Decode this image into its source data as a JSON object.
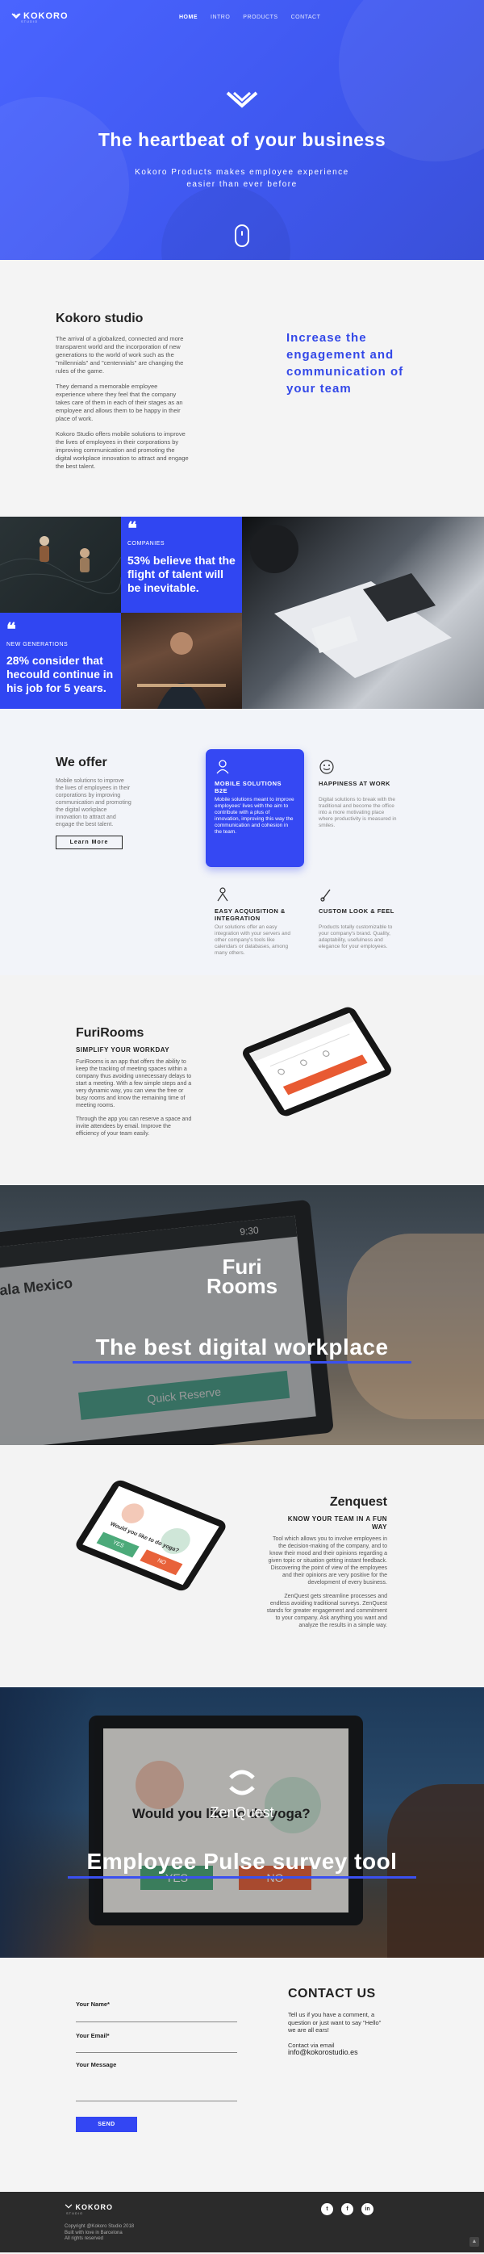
{
  "brand": {
    "name": "KOKORO",
    "sub": "STUDIO"
  },
  "nav": {
    "items": [
      "HOME",
      "INTRO",
      "PRODUCTS",
      "CONTACT"
    ]
  },
  "hero": {
    "title": "The heartbeat of your business",
    "subtitle": "Kokoro Products makes employee experience easier than ever before"
  },
  "studio": {
    "title": "Kokoro studio",
    "paragraphs": [
      "The arrival of a globalized, connected and more transparent world and the incorporation of new generations to the world of work such as the \"millennials\" and \"centennials\" are changing the rules of the game.",
      "They demand a memorable employee experience where they feel that the company takes care of them in each of their stages as an employee and allows them to be happy in their place of work.",
      "Kokoro Studio offers mobile solutions to improve the lives of employees in their corporations by improving communication and promoting the digital workplace innovation to attract and engage the best talent."
    ],
    "quote": "Increase the engagement and communication of your team"
  },
  "grid": {
    "companies": {
      "label": "COMPANIES",
      "stat": "53% believe that the flight of talent will be inevitable."
    },
    "generations": {
      "label": "NEW GENERATIONS",
      "stat": "28% consider that hecould continue in his job for 5 years."
    }
  },
  "offer": {
    "title": "We offer",
    "text": "Mobile solutions to improve the lives of employees in their corporations by improving communication and promoting the digital workplace innovation to attract and engage the best talent.",
    "button": "Learn More",
    "features": [
      {
        "title": "MOBILE SOLUTIONS B2E",
        "text": "Mobile solutions meant to improve employees' lives with the aim to contribute with a plus of innovation, improving this way the communication and cohesion in the team."
      },
      {
        "title": "HAPPINESS AT WORK",
        "text": "Digital solutions to break with the traditional and become the office into a more motivating place where productivity is measured in smiles."
      },
      {
        "title": "EASY ACQUISITION & INTEGRATION",
        "text": "Our solutions offer an easy integration with your servers and other company's tools like calendars or databases, among many others."
      },
      {
        "title": "CUSTOM LOOK & FEEL",
        "text": "Products totally customizable to your company's brand. Quality, adaptability, usefulness and elegance for your employees."
      }
    ]
  },
  "furirooms": {
    "title": "FuriRooms",
    "subtitle": "SIMPLIFY YOUR WORKDAY",
    "paragraphs": [
      "FuriRooms is an app that offers the ability to keep the tracking of meeting spaces within a company thus avoiding unnecessary delays to start a meeting. With a few simple steps and a very dynamic way, you can view the free or busy rooms and know the remaining time of meeting rooms.",
      "Through the app you can reserve a space and invite attendees by email. Improve the efficiency of your team easily."
    ]
  },
  "furiBanner": {
    "logo_line1": "Furi",
    "logo_line2": "Rooms",
    "title": "The best digital workplace",
    "screen_room": "Sala Mexico",
    "screen_time": "9:30",
    "screen_button": "Quick Reserve"
  },
  "zenquest": {
    "title": "Zenquest",
    "subtitle": "KNOW YOUR TEAM IN A FUN WAY",
    "paragraphs": [
      "Tool which allows you to involve employees in the decision-making of the company, and to know their mood and their opinions regarding a given topic or situation getting instant feedback. Discovering the point of view of the employees and their opinions are very positive for the development of every business.",
      "ZenQuest gets streamline processes and endless avoiding traditional surveys. ZenQuest stands for greater engagement and commitment to your company. Ask anything you want and analyze the results in a simple way."
    ],
    "screen_question": "Would you like to do yoga?",
    "screen_yes": "YES",
    "screen_no": "NO"
  },
  "zqBanner": {
    "question": "Would you like to do yoga?",
    "yes": "YES",
    "no": "NO",
    "logo": "ZenQuest",
    "title": "Employee Pulse survey tool"
  },
  "contact": {
    "name_label": "Your Name*",
    "email_label": "Your Email*",
    "message_label": "Your Message",
    "send": "SEND",
    "title": "CONTACT US",
    "text": "Tell us if you have a comment, a question or just want to say \"Hello\" we are all ears!",
    "email_intro": "Contact via email",
    "email": "info@kokorostudio.es"
  },
  "footer": {
    "copyright": "Copyright @Kokoro Studio 2018",
    "line2": "Built with love in Barcelona",
    "line3": "All rights reserved",
    "social": [
      "t",
      "f",
      "in"
    ]
  },
  "colors": {
    "accent": "#3046f2",
    "dark": "#2b2b2b",
    "light": "#f4f4f4"
  }
}
